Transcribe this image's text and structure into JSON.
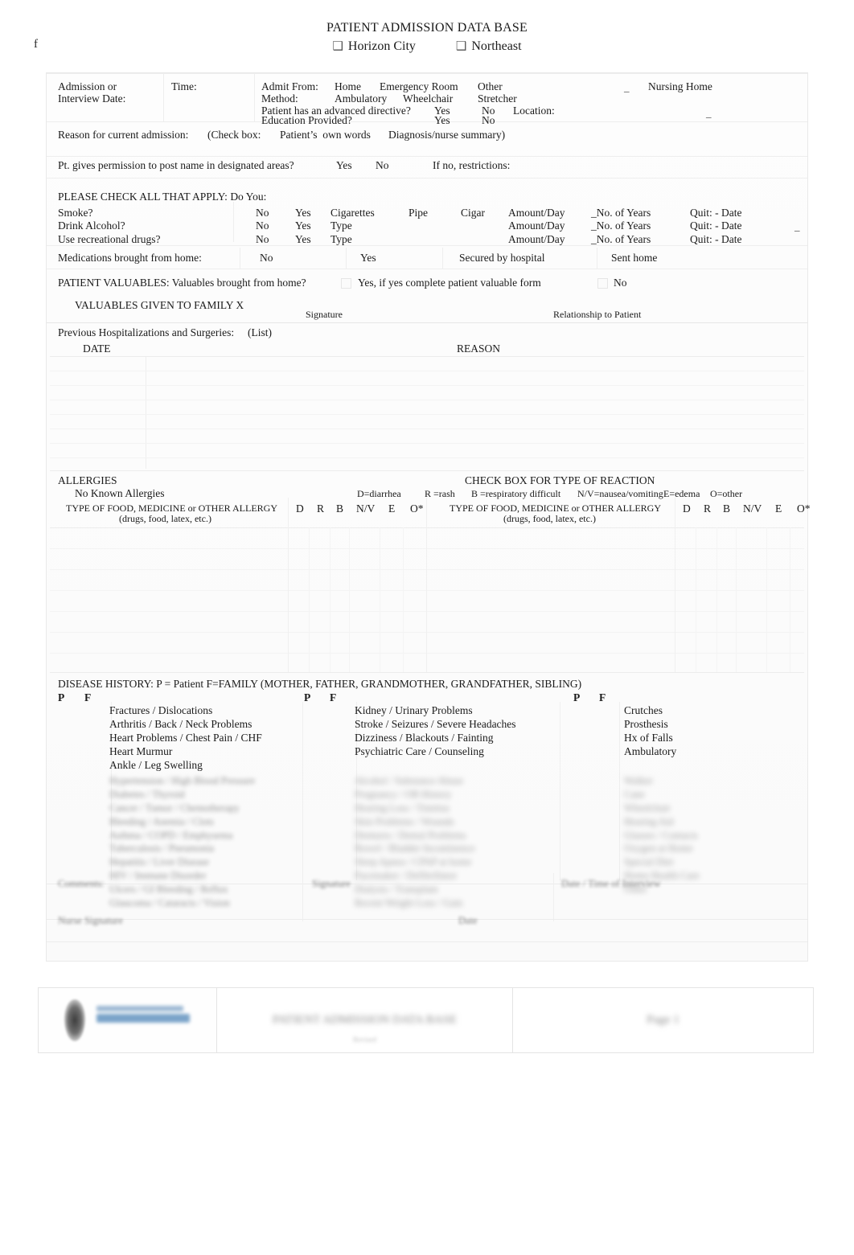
{
  "document": {
    "title": "PATIENT ADMISSION DATA BASE",
    "facility_options": [
      "Horizon City",
      "Northeast"
    ],
    "checkbox_glyph": "❑",
    "stray_margin_char": "f"
  },
  "admission": {
    "date_label": "Admission or",
    "date_label_line2": "Interview Date:",
    "time_label": "Time:",
    "admit_from_label": "Admit From:",
    "admit_from_options": [
      "Home",
      "Emergency Room",
      "Other",
      "Nursing Home"
    ],
    "method_label": "Method:",
    "method_options": [
      "Ambulatory",
      "Wheelchair",
      "Stretcher"
    ],
    "advanced_directive_label": "Patient has an advanced directive?",
    "advanced_directive_options": [
      "Yes",
      "No"
    ],
    "location_label": "Location:",
    "education_provided_label": "Education Provided?",
    "education_provided_options": [
      "Yes",
      "No"
    ],
    "underscore_mark": "_"
  },
  "reason": {
    "label": "Reason for current admission:",
    "check_box_label": "(Check box:",
    "options": [
      "Patient’s  own words",
      "Diagnosis/nurse summary)"
    ]
  },
  "permission": {
    "label": "Pt. gives permission to post name in designated areas?",
    "options": [
      "Yes",
      "No"
    ],
    "restrictions_label": "If no, restrictions:"
  },
  "habits": {
    "section_label": "PLEASE CHECK ALL THAT APPLY: Do You:",
    "rows": [
      {
        "question": "Smoke?",
        "no": "No",
        "yes": "Yes",
        "type_label": "Cigarettes",
        "extra_options": [
          "Pipe",
          "Cigar"
        ],
        "amount_label": "Amount/Day",
        "years_label": "_No. of Years",
        "quit_label": "Quit: - Date"
      },
      {
        "question": "Drink Alcohol?",
        "no": "No",
        "yes": "Yes",
        "type_label": "Type",
        "extra_options": [],
        "amount_label": "Amount/Day",
        "years_label": "_No. of Years",
        "quit_label": "Quit: - Date"
      },
      {
        "question": "Use recreational drugs?",
        "no": "No",
        "yes": "Yes",
        "type_label": "Type",
        "extra_options": [],
        "amount_label": "Amount/Day",
        "years_label": "_No. of Years",
        "quit_label": "Quit: - Date"
      }
    ]
  },
  "medications": {
    "label": "Medications brought from home:",
    "options": [
      "No",
      "Yes",
      "Secured by hospital",
      "Sent home"
    ]
  },
  "valuables": {
    "label": "PATIENT VALUABLES: Valuables brought from home?",
    "yes_option": "Yes, if yes complete patient valuable form",
    "no_option": "No",
    "given_to_family_label": "VALUABLES GIVEN TO FAMILY X",
    "signature_label": "Signature",
    "relationship_label": "Relationship to Patient"
  },
  "history": {
    "label": "Previous Hospitalizations and Surgeries:",
    "list_label": "(List)",
    "col_date": "DATE",
    "col_reason": "REASON",
    "row_count": 8
  },
  "allergies": {
    "section_label": "ALLERGIES",
    "no_known_label": "No Known Allergies",
    "reaction_header": "CHECK BOX FOR TYPE OF REACTION",
    "legend": [
      "D=diarrhea",
      "R =rash",
      "B =respiratory difficult",
      "N/V=nausea/vomiting",
      "E=edema",
      "O=other"
    ],
    "col_header": "TYPE OF FOOD, MEDICINE or OTHER ALLERGY",
    "col_subheader": "(drugs, food, latex, etc.)",
    "reaction_columns": [
      "D",
      "R",
      "B",
      "N/V",
      "E",
      "O*"
    ],
    "row_count": 7
  },
  "disease_history": {
    "section_label": "DISEASE HISTORY: P = Patient F=FAMILY (MOTHER, FATHER, GRANDMOTHER, GRANDFATHER, SIBLING)",
    "pf_headers": [
      "P",
      "F"
    ],
    "columns": [
      {
        "items": [
          "Fractures / Dislocations",
          "Arthritis / Back / Neck Problems",
          "Heart Problems / Chest Pain / CHF",
          "Heart Murmur",
          "Ankle / Leg Swelling"
        ]
      },
      {
        "items": [
          "Kidney / Urinary Problems",
          "Stroke / Seizures / Severe Headaches",
          "Dizziness / Blackouts / Fainting",
          "Psychiatric Care / Counseling"
        ]
      },
      {
        "items": [
          "Crutches",
          "Prosthesis",
          "Hx of Falls",
          "Ambulatory"
        ]
      }
    ],
    "illegible_note": "(lower rows of this section are illegible in the scan)"
  },
  "footer": {
    "cells": [
      "logo",
      "illegible-center-text",
      "illegible-right-text"
    ],
    "illegible_note": "(footer text is blurred and unreadable in the scan)"
  }
}
